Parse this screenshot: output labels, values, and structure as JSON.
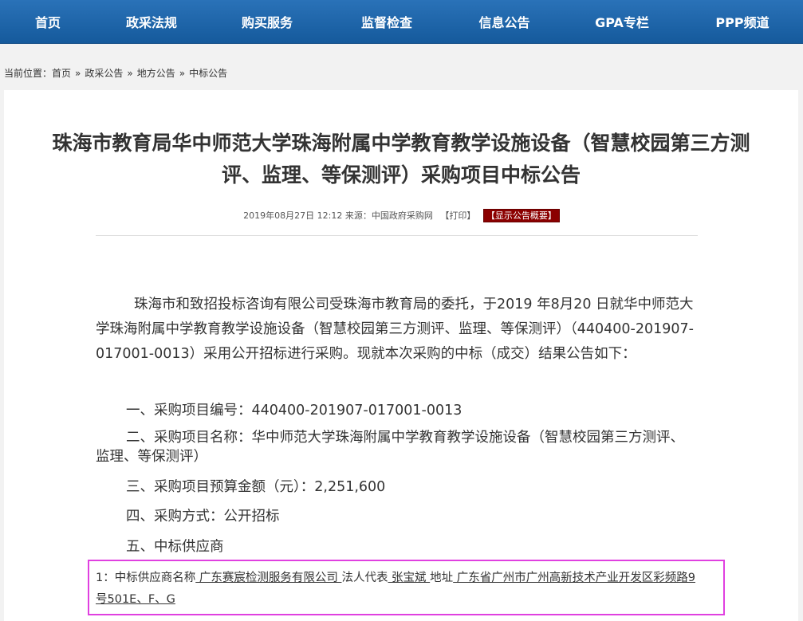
{
  "nav": {
    "items": [
      {
        "label": "首页"
      },
      {
        "label": "政采法规"
      },
      {
        "label": "购买服务"
      },
      {
        "label": "监督检查"
      },
      {
        "label": "信息公告"
      },
      {
        "label": "GPA专栏"
      },
      {
        "label": "PPP频道"
      }
    ]
  },
  "breadcrumb": {
    "prefix": "当前位置：",
    "links": [
      "首页",
      "政采公告",
      "地方公告",
      "中标公告"
    ],
    "separator": "»"
  },
  "article": {
    "title_line1": "珠海市教育局华中师范大学珠海附属中学教育教学设施设备（智慧校园第三方测",
    "title_line2": "评、监理、等保测评）采购项目中标公告",
    "meta_datetime": "2019年08月27日 12:12",
    "meta_source": "来源：中国政府采购网",
    "print_label": "【打印】",
    "summary_label": "【显示公告概要】",
    "intro": "珠海市和致招投标咨询有限公司受珠海市教育局的委托，于2019 年8月20 日就华中师范大学珠海附属中学教育教学设施设备（智慧校园第三方测评、监理、等保测评）（440400-201907-017001-0013）采用公开招标进行采购。现就本次采购的中标（成交）结果公告如下：",
    "item1": "一、采购项目编号：440400-201907-017001-0013",
    "item2": "二、采购项目名称：华中师范大学珠海附属中学教育教学设施设备（智慧校园第三方测评、监理、等保测评）",
    "item3": "三、采购项目预算金额（元）：2,251,600",
    "item4": "四、采购方式：公开招标",
    "item5": "五、中标供应商",
    "supplier": {
      "lead": "1：中标供应商名称",
      "name": " 广东赛宸检测服务有限公司 ",
      "rep_label": "法人代表",
      "rep": " 张宝斌 ",
      "addr_label": "地址",
      "addr": " 广东省广州市广州高新技术产业开发区彩频路9号501E、F、G "
    }
  },
  "colors": {
    "nav_bg": "#1a5fa3",
    "summary_badge": "#8b0000",
    "highlight_box": "#e040e0"
  }
}
